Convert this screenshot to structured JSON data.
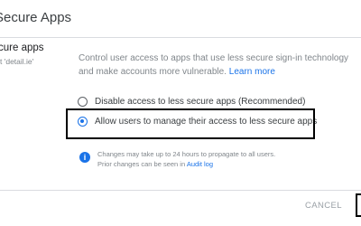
{
  "dialog": {
    "title": "Secure Apps"
  },
  "section": {
    "title": "cure apps",
    "subtitle": "t 'detail.ie'"
  },
  "description": {
    "text": "Control user access to apps that use less secure sign-in technology and make accounts more vulnerable. ",
    "link": "Learn more"
  },
  "options": [
    {
      "label": "Disable access to less secure apps (Recommended)",
      "selected": false
    },
    {
      "label": "Allow users to manage their access to less secure apps",
      "selected": true
    }
  ],
  "info": {
    "icon": "info-icon",
    "line1": "Changes may take up to 24 hours to propagate to all users.",
    "line2_prefix": "Prior changes can be seen in ",
    "line2_link": "Audit log"
  },
  "footer": {
    "cancel_label": "CANCEL"
  },
  "colors": {
    "accent": "#1a73e8",
    "text": "#3c4043",
    "muted": "#80868b"
  }
}
